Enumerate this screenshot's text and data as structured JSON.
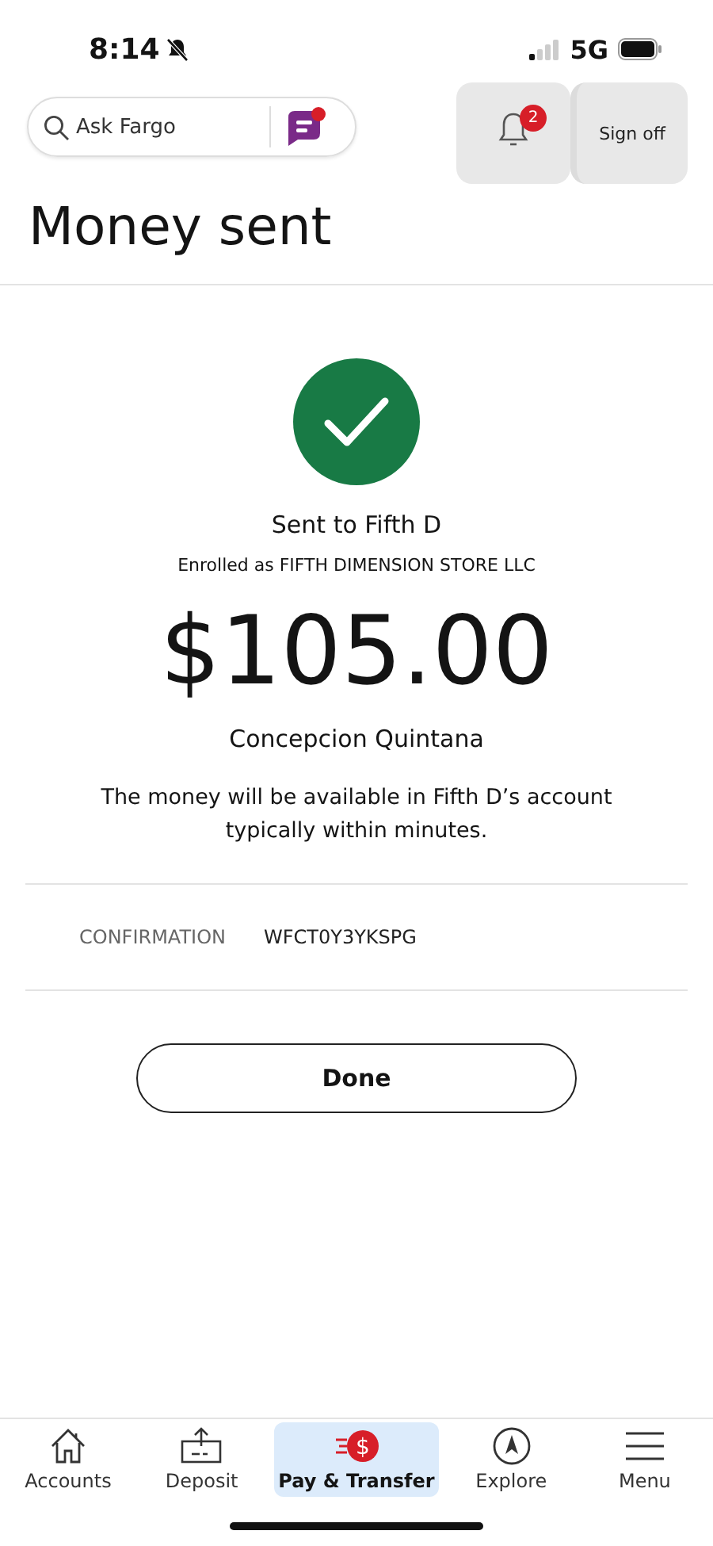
{
  "status_bar": {
    "time": "8:14",
    "network": "5G"
  },
  "header": {
    "search": {
      "placeholder": "Ask Fargo"
    },
    "notifications": {
      "count": "2"
    },
    "sign_off": "Sign off"
  },
  "title": "Money sent",
  "receipt": {
    "recipient": "Sent to Fifth D",
    "enrolled": "Enrolled as FIFTH DIMENSION STORE LLC",
    "amount": "$105.00",
    "payer": "Concepcion Quintana",
    "message": "The money will be available in Fifth D’s account typically within minutes.",
    "confirmation_label": "CONFIRMATION",
    "confirmation_value": "WFCT0Y3YKSPG"
  },
  "done_button": "Done",
  "tab_bar": [
    {
      "label": "Accounts",
      "selected": false
    },
    {
      "label": "Deposit",
      "selected": false
    },
    {
      "label": "Pay & Transfer",
      "selected": true,
      "icon_text": "$"
    },
    {
      "label": "Explore",
      "selected": false
    },
    {
      "label": "Menu",
      "selected": false
    }
  ]
}
